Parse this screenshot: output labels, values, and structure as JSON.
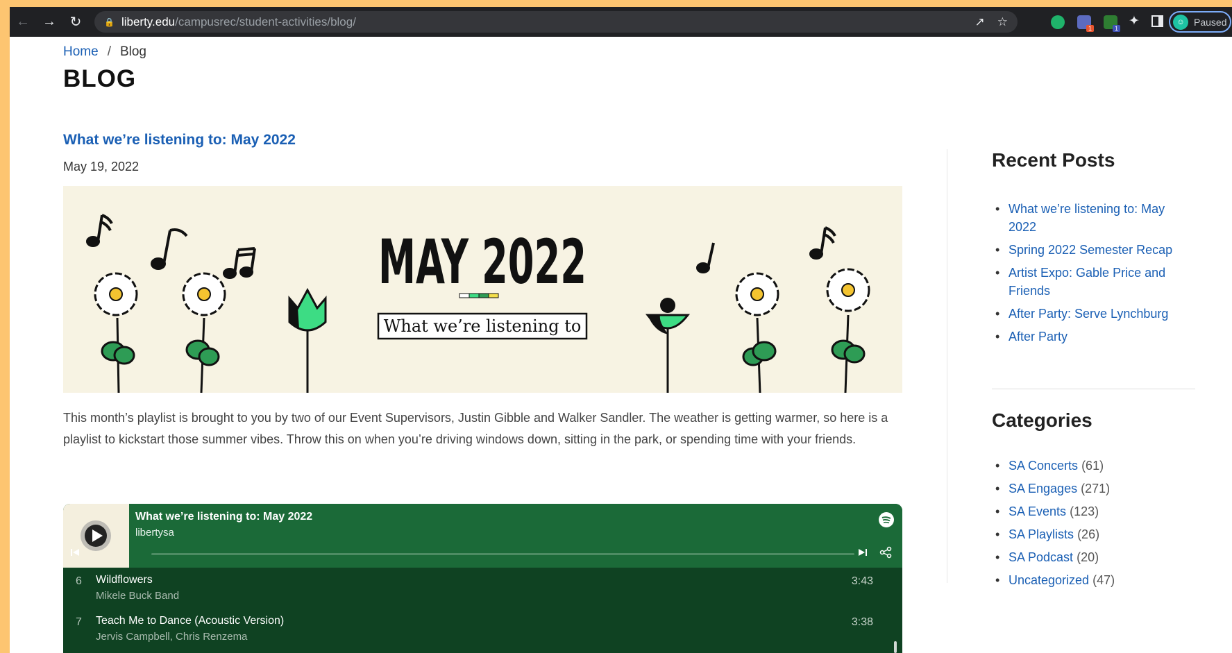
{
  "browser": {
    "url_domain": "liberty.edu",
    "url_path": "/campusrec/student-activities/blog/",
    "profile_status": "Paused",
    "extension_badges": [
      "1",
      "1"
    ]
  },
  "breadcrumb": {
    "home": "Home",
    "separator": "/",
    "current": "Blog"
  },
  "page_title": "BLOG",
  "post": {
    "title": "What we’re listening to: May 2022",
    "date": "May 19, 2022",
    "banner": {
      "headline": "MAY 2022",
      "subtitle": "What we’re listening to"
    },
    "excerpt": "This month’s playlist is brought to you by two of our Event Supervisors, Justin Gibble and Walker Sandler. The weather is getting warmer, so here is a playlist to kickstart those summer vibes. Throw this on when you’re driving windows down, sitting in the park, or spending time with your friends."
  },
  "player": {
    "playlist_title": "What we’re listening to: May 2022",
    "owner": "libertysa",
    "tracks": [
      {
        "num": "6",
        "name": "Wildflowers",
        "artist": "Mikele Buck Band",
        "duration": "3:43"
      },
      {
        "num": "7",
        "name": "Teach Me to Dance (Acoustic Version)",
        "artist": "Jervis Campbell, Chris Renzema",
        "duration": "3:38"
      }
    ]
  },
  "sidebar": {
    "recent_heading": "Recent Posts",
    "recent": [
      "What we’re listening to: May 2022",
      "Spring 2022 Semester Recap",
      "Artist Expo: Gable Price and Friends",
      "After Party: Serve Lynchburg",
      "After Party"
    ],
    "categories_heading": "Categories",
    "categories": [
      {
        "name": "SA Concerts",
        "count": "(61)"
      },
      {
        "name": "SA Engages",
        "count": "(271)"
      },
      {
        "name": "SA Events",
        "count": "(123)"
      },
      {
        "name": "SA Playlists",
        "count": "(26)"
      },
      {
        "name": "SA Podcast",
        "count": "(20)"
      },
      {
        "name": "Uncategorized",
        "count": "(47)"
      }
    ]
  },
  "colors": {
    "page_bg": "#fdc571",
    "link": "#1a5fb4",
    "chrome_bg": "#202124",
    "player_header": "#1b6a38",
    "player_body": "#0f4222",
    "banner_bg": "#f7f3e3",
    "banner_green": "#3ddc84"
  }
}
